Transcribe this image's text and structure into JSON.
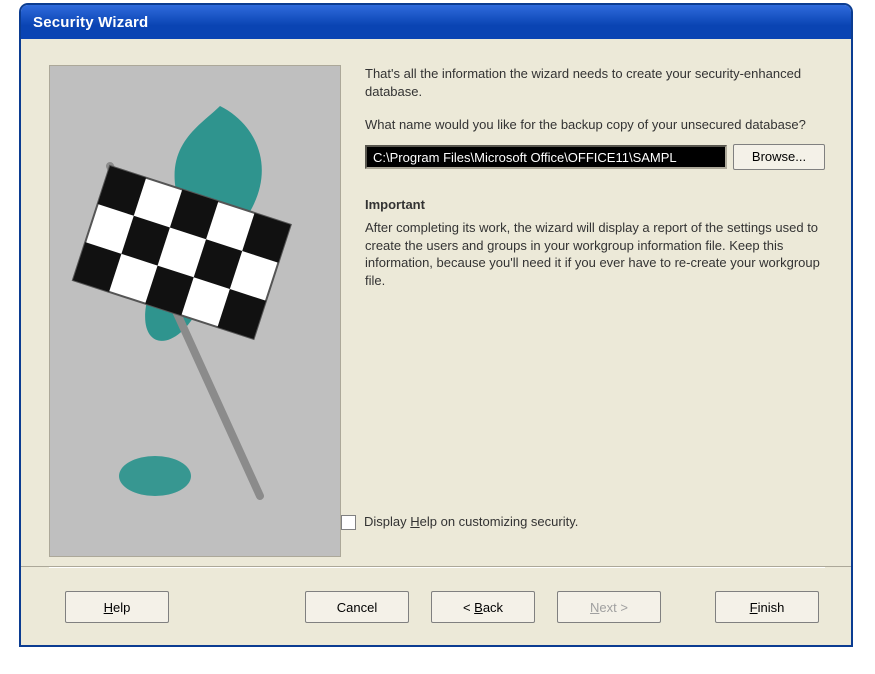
{
  "window": {
    "title": "Security Wizard"
  },
  "main": {
    "intro": "That's all the information the wizard needs to create your security-enhanced database.",
    "prompt": "What name would you like for the backup copy of your unsecured database?",
    "path_value": "C:\\Program Files\\Microsoft Office\\OFFICE11\\SAMPL",
    "browse_label": "Browse...",
    "important_heading": "Important",
    "important_text": "After completing its work, the wizard will display a report of the settings used to create the users and groups in your workgroup information file. Keep this information, because you'll need it if you ever have to re-create your workgroup file.",
    "checkbox_label_pre": "Display ",
    "checkbox_label_u": "H",
    "checkbox_label_post": "elp on customizing security."
  },
  "buttons": {
    "help_u": "H",
    "help_post": "elp",
    "cancel": "Cancel",
    "back_pre": "< ",
    "back_u": "B",
    "back_post": "ack",
    "next_u": "N",
    "next_post": "ext >",
    "finish_u": "F",
    "finish_post": "inish"
  }
}
